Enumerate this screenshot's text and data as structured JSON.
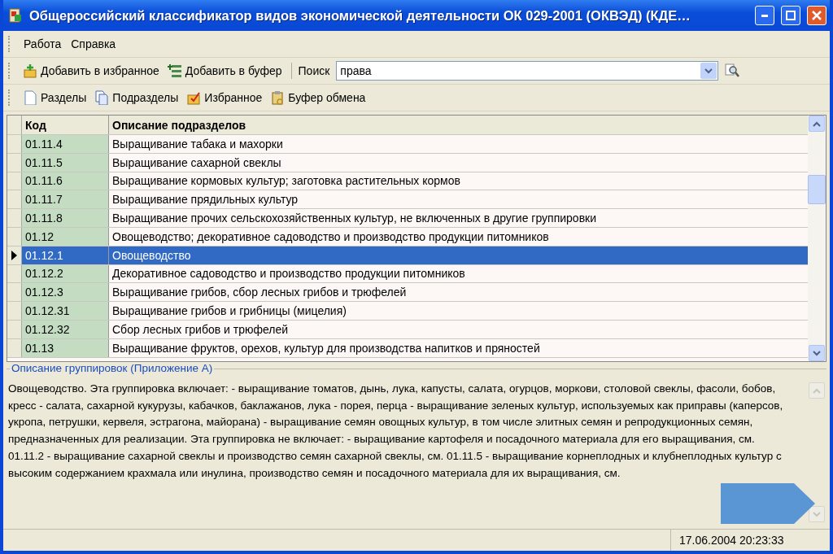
{
  "window": {
    "title": "Общероссийский классификатор видов экономической деятельности ОК 029-2001 (ОКВЭД) (КДЕ…"
  },
  "menu": [
    "Работа",
    "Справка"
  ],
  "toolbar1": [
    {
      "kind": "favadd",
      "label": "Добавить в избранное"
    },
    {
      "kind": "bufadd",
      "label": "Добавить в буфер"
    }
  ],
  "search": {
    "label": "Поиск",
    "value": "права"
  },
  "toolbar2": [
    {
      "kind": "page",
      "label": "Разделы"
    },
    {
      "kind": "pages",
      "label": "Подразделы"
    },
    {
      "kind": "fav",
      "label": "Избранное"
    },
    {
      "kind": "clip",
      "label": "Буфер обмена"
    }
  ],
  "table": {
    "columns": [
      "Код",
      "Описание подразделов"
    ],
    "rows": [
      {
        "code": "01.11.4",
        "text": "Выращивание табака и махорки",
        "selected": false
      },
      {
        "code": "01.11.5",
        "text": "Выращивание сахарной свеклы",
        "selected": false
      },
      {
        "code": "01.11.6",
        "text": "Выращивание кормовых культур; заготовка растительных кормов",
        "selected": false
      },
      {
        "code": "01.11.7",
        "text": "Выращивание прядильных культур",
        "selected": false
      },
      {
        "code": "01.11.8",
        "text": "Выращивание прочих сельскохозяйственных культур, не включенных в другие группировки",
        "selected": false
      },
      {
        "code": "01.12",
        "text": "Овощеводство; декоративное садоводство и производство продукции питомников",
        "selected": false
      },
      {
        "code": "01.12.1",
        "text": "Овощеводство",
        "selected": true
      },
      {
        "code": "01.12.2",
        "text": "Декоративное садоводство и производство продукции питомников",
        "selected": false
      },
      {
        "code": "01.12.3",
        "text": "Выращивание грибов, сбор лесных грибов и трюфелей",
        "selected": false
      },
      {
        "code": "01.12.31",
        "text": "Выращивание грибов и грибницы (мицелия)",
        "selected": false
      },
      {
        "code": "01.12.32",
        "text": "Сбор лесных грибов и трюфелей",
        "selected": false
      },
      {
        "code": "01.13",
        "text": "Выращивание фруктов, орехов, культур для производства напитков и пряностей",
        "selected": false
      }
    ]
  },
  "description": {
    "title": "Описание группировок  (Приложение А)",
    "text": "Овощеводство. Эта группировка включает: - выращивание томатов, дынь, лука, капусты, салата, огурцов, моркови, столовой свеклы, фасоли, бобов, кресс - салата, сахарной кукурузы, кабачков, баклажанов, лука - порея, перца - выращивание зеленых культур, используемых как приправы (каперсов, укропа, петрушки, кервеля, эстрагона, майорана) - выращивание семян овощных культур, в том числе элитных семян и репродукционных семян, предназначенных для реализации. Эта группировка не включает: - выращивание картофеля и посадочного материала для его выращивания, см. 01.11.2 - выращивание сахарной свеклы и производство семян сахарной свеклы, см. 01.11.5 - выращивание корнеплодных и клубнеплодных культур с высоким содержанием крахмала или инулина, производство семян и посадочного материала для их выращивания, см."
  },
  "status_bar": {
    "datetime": "17.06.2004 20:23:33"
  }
}
